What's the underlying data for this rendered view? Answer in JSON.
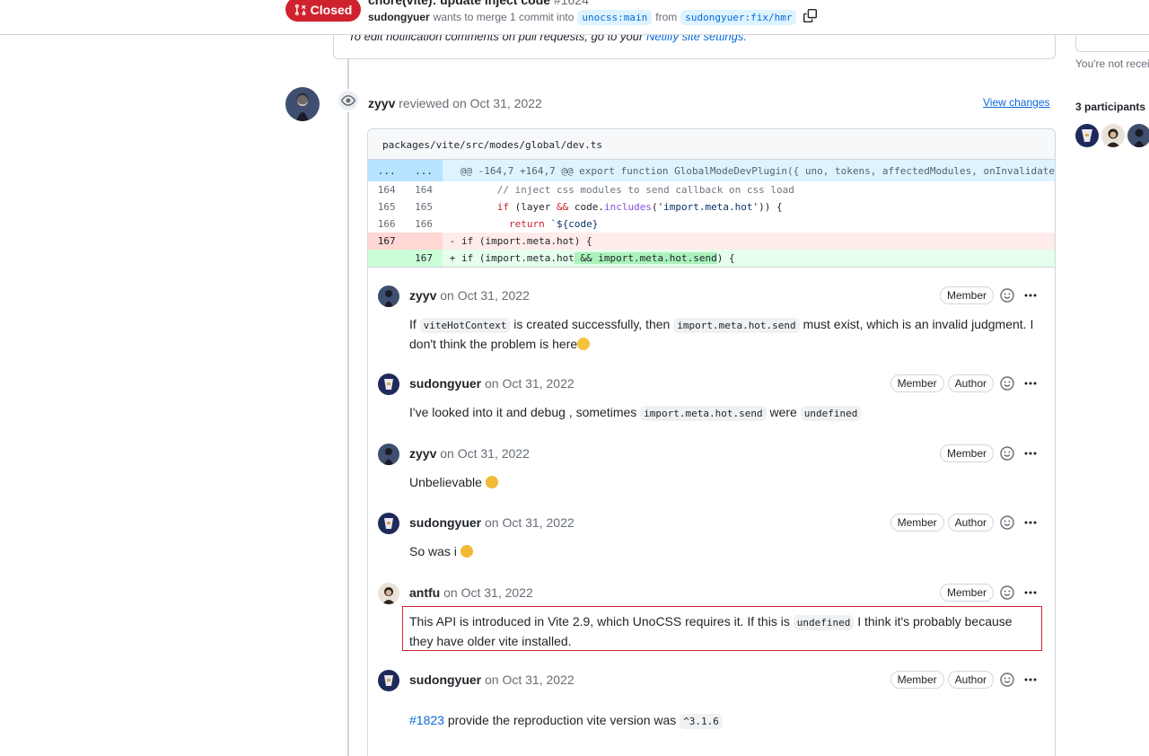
{
  "header": {
    "state_label": "Closed",
    "title": "chore(vite): update inject code",
    "pr_number": "#1624",
    "author": "sudongyuer",
    "merge_text": "wants to merge 1 commit into",
    "base_branch": "unocss:main",
    "from_text": "from",
    "head_branch": "sudongyuer:fix/hmr"
  },
  "netlify": {
    "text_before": "To edit notification comments on pull requests, go to your",
    "link": "Netlify site settings."
  },
  "review": {
    "reviewer": "zyyv",
    "action": "reviewed on Oct 31, 2022",
    "view_changes": "View changes",
    "file_path": "packages/vite/src/modes/global/dev.ts",
    "hunk": {
      "old_ln": "...",
      "new_ln": "...",
      "text": "@@ -164,7 +164,7 @@ export function GlobalModeDevPlugin({ uno, tokens, affectedModules, onInvalidate"
    },
    "lines": [
      {
        "old": "164",
        "new": "164",
        "type": "ctx"
      },
      {
        "old": "165",
        "new": "165",
        "type": "ctx"
      },
      {
        "old": "166",
        "new": "166",
        "type": "ctx"
      },
      {
        "old": "167",
        "new": "",
        "type": "del"
      },
      {
        "old": "",
        "new": "167",
        "type": "add"
      }
    ],
    "code": {
      "line1": "// inject css modules to send callback on css load",
      "line2_kw": "if",
      "line2_a": " (layer ",
      "line2_op": "&&",
      "line2_b": " code.",
      "line2_fn": "includes",
      "line2_c": "(",
      "line2_str": "'import.meta.hot'",
      "line2_d": ")) {",
      "line3_kw": "return",
      "line3_rest": " `${code}",
      "line4": "- if (import.meta.hot) {",
      "line5_a": "+ if (import.meta.hot",
      "line5_hl": " && import.meta.hot.send",
      "line5_b": ") {"
    }
  },
  "comments": [
    {
      "author": "zyyv",
      "date": "on Oct 31, 2022",
      "badges": [
        "Member"
      ],
      "t1": "If",
      "c1": "viteHotContext",
      "t2": "is created successfully, then",
      "c2": "import.meta.hot.send",
      "t3": "must exist, which is an invalid judgment. I don't think the problem is here"
    },
    {
      "author": "sudongyuer",
      "date": "on Oct 31, 2022",
      "badges": [
        "Member",
        "Author"
      ],
      "t1": "I've looked into it and debug , sometimes",
      "c1": "import.meta.hot.send",
      "t2": "were",
      "c2": "undefined"
    },
    {
      "author": "zyyv",
      "date": "on Oct 31, 2022",
      "badges": [
        "Member"
      ],
      "t1": "Unbelievable"
    },
    {
      "author": "sudongyuer",
      "date": "on Oct 31, 2022",
      "badges": [
        "Member",
        "Author"
      ],
      "t1": "So was i"
    },
    {
      "author": "antfu",
      "date": "on Oct 31, 2022",
      "badges": [
        "Member"
      ],
      "t1": "This API is introduced in Vite 2.9, which UnoCSS requires it. If this is",
      "c1": "undefined",
      "t2": "I think it's probably because they have older vite installed."
    },
    {
      "author": "sudongyuer",
      "date": "on Oct 31, 2022",
      "badges": [
        "Member",
        "Author"
      ],
      "link": "#1823",
      "t1": "provide the reproduction vite version was",
      "c1": "^3.1.6"
    }
  ],
  "sidebar": {
    "not_receiving": "You're not receiv",
    "participants": "3 participants"
  },
  "colors": {
    "closed": "#cf222e",
    "link": "#0969da",
    "highlight_border": "#d1242f"
  }
}
